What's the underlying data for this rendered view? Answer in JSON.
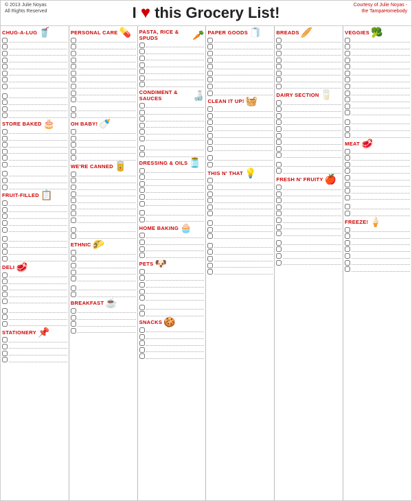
{
  "header": {
    "copyright": "© 2013 Julie Noyas\nAll Rights Reserved",
    "title": "I",
    "heart": "♥",
    "title2": "this Grocery List!",
    "courtesy": "Courtesy of Julie Noyas -\nthe TampaHomebody"
  },
  "columns": [
    {
      "id": "col1",
      "sections": [
        {
          "name": "CHUG-A-LUG",
          "icon": "🥤",
          "rows": 8
        },
        {
          "name": "",
          "icon": "",
          "rows": 4
        },
        {
          "name": "STORE BAKED",
          "icon": "🎂",
          "rows": 6
        },
        {
          "name": "",
          "icon": "",
          "rows": 3
        },
        {
          "name": "FRUIT-FILLED",
          "icon": "📋",
          "rows": 5
        },
        {
          "name": "",
          "icon": "",
          "rows": 4
        },
        {
          "name": "DELI",
          "icon": "🥩",
          "rows": 5
        },
        {
          "name": "",
          "icon": "",
          "rows": 3
        },
        {
          "name": "STATIONERY",
          "icon": "📌",
          "rows": 4
        }
      ]
    },
    {
      "id": "col2",
      "sections": [
        {
          "name": "PERSONAL CARE",
          "icon": "💊",
          "rows": 10
        },
        {
          "name": "",
          "icon": "",
          "rows": 2
        },
        {
          "name": "OH BABY!",
          "icon": "🍼",
          "rows": 5
        },
        {
          "name": "WE'RE CANNED",
          "icon": "🥫",
          "rows": 8
        },
        {
          "name": "",
          "icon": "",
          "rows": 2
        },
        {
          "name": "ETHNIC",
          "icon": "🌮",
          "rows": 5
        },
        {
          "name": "",
          "icon": "",
          "rows": 2
        },
        {
          "name": "BREAKFAST",
          "icon": "☕",
          "rows": 4
        }
      ]
    },
    {
      "id": "col3",
      "sections": [
        {
          "name": "PASTA, RICE & SPUDS",
          "icon": "🥕",
          "rows": 7
        },
        {
          "name": "CONDIMENT & SAUCES",
          "icon": "🍶",
          "rows": 6
        },
        {
          "name": "",
          "icon": "",
          "rows": 2
        },
        {
          "name": "DRESSING & OILS",
          "icon": "🫙",
          "rows": 6
        },
        {
          "name": "",
          "icon": "",
          "rows": 2
        },
        {
          "name": "HOME BAKING",
          "icon": "🧁",
          "rows": 4
        },
        {
          "name": "PETS",
          "icon": "🐶",
          "rows": 5
        },
        {
          "name": "",
          "icon": "",
          "rows": 2
        },
        {
          "name": "SNACKS",
          "icon": "🍪",
          "rows": 5
        }
      ]
    },
    {
      "id": "col4",
      "sections": [
        {
          "name": "PAPER GOODS",
          "icon": "🧻",
          "rows": 9
        },
        {
          "name": "CLEAN IT UP!",
          "icon": "🧺",
          "rows": 7
        },
        {
          "name": "",
          "icon": "",
          "rows": 2
        },
        {
          "name": "THIS N' THAT",
          "icon": "💡",
          "rows": 6
        },
        {
          "name": "",
          "icon": "",
          "rows": 3
        },
        {
          "name": "",
          "icon": "",
          "rows": 5
        }
      ]
    },
    {
      "id": "col5",
      "sections": [
        {
          "name": "BREADS",
          "icon": "🥖",
          "rows": 8
        },
        {
          "name": "DAIRY SECTION",
          "icon": "🥛",
          "rows": 9
        },
        {
          "name": "",
          "icon": "",
          "rows": 2
        },
        {
          "name": "FRESH N' FRUITY",
          "icon": "🍎",
          "rows": 8
        },
        {
          "name": "",
          "icon": "",
          "rows": 4
        }
      ]
    },
    {
      "id": "col6",
      "sections": [
        {
          "name": "VEGGIES",
          "icon": "🥦",
          "rows": 12
        },
        {
          "name": "",
          "icon": "",
          "rows": 3
        },
        {
          "name": "MEAT",
          "icon": "🥩",
          "rows": 8
        },
        {
          "name": "",
          "icon": "",
          "rows": 2
        },
        {
          "name": "FREEZE!",
          "icon": "🍦",
          "rows": 7
        }
      ]
    }
  ]
}
